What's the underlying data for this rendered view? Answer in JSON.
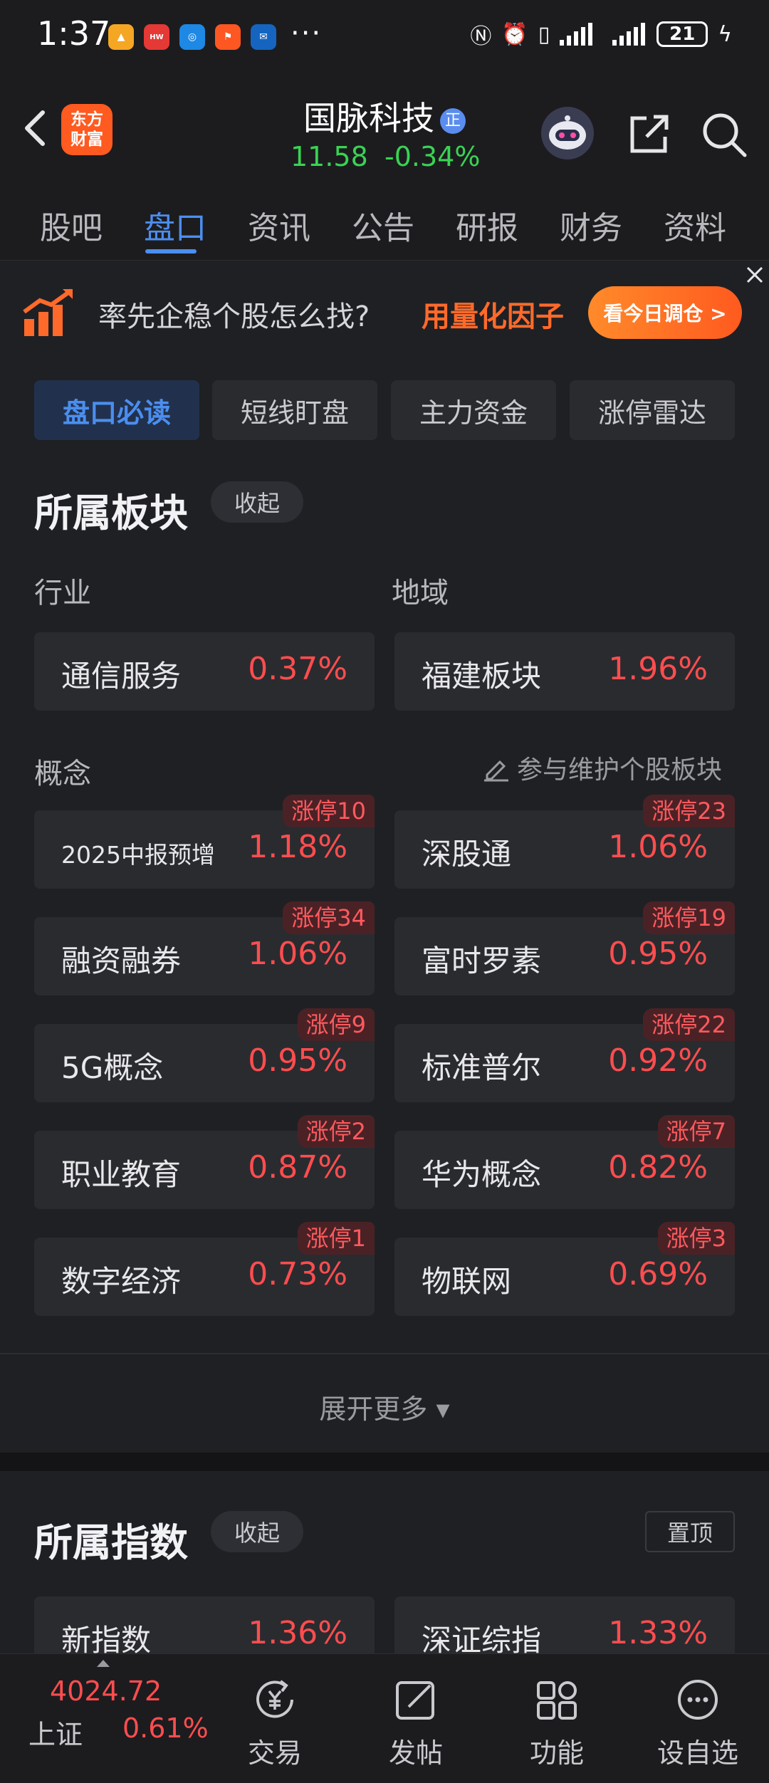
{
  "status_bar": {
    "time": "1:37",
    "dots": "···",
    "battery": "21"
  },
  "header": {
    "logo_line1": "东方",
    "logo_line2": "财富",
    "stock_name": "国脉科技",
    "badge": "正",
    "price": "11.58",
    "change": "-0.34%"
  },
  "tabs": [
    {
      "label": "股吧"
    },
    {
      "label": "盘口"
    },
    {
      "label": "资讯"
    },
    {
      "label": "公告"
    },
    {
      "label": "研报"
    },
    {
      "label": "财务"
    },
    {
      "label": "资料"
    }
  ],
  "banner": {
    "text": "率先企稳个股怎么找?",
    "highlight": "用量化因子",
    "button": "看今日调仓 >"
  },
  "subtabs": [
    {
      "label": "盘口必读"
    },
    {
      "label": "短线盯盘"
    },
    {
      "label": "主力资金"
    },
    {
      "label": "涨停雷达"
    }
  ],
  "sector_section": {
    "title": "所属板块",
    "collapse": "收起",
    "industry_label": "行业",
    "region_label": "地域",
    "industry": {
      "name": "通信服务",
      "pct": "0.37%"
    },
    "region": {
      "name": "福建板块",
      "pct": "1.96%"
    },
    "concept_label": "概念",
    "maintain_link": "参与维护个股板块",
    "concepts": [
      {
        "name": "2025中报预增",
        "pct": "1.18%",
        "badge": "涨停10"
      },
      {
        "name": "深股通",
        "pct": "1.06%",
        "badge": "涨停23"
      },
      {
        "name": "融资融券",
        "pct": "1.06%",
        "badge": "涨停34"
      },
      {
        "name": "富时罗素",
        "pct": "0.95%",
        "badge": "涨停19"
      },
      {
        "name": "5G概念",
        "pct": "0.95%",
        "badge": "涨停9"
      },
      {
        "name": "标准普尔",
        "pct": "0.92%",
        "badge": "涨停22"
      },
      {
        "name": "职业教育",
        "pct": "0.87%",
        "badge": "涨停2"
      },
      {
        "name": "华为概念",
        "pct": "0.82%",
        "badge": "涨停7"
      },
      {
        "name": "数字经济",
        "pct": "0.73%",
        "badge": "涨停1"
      },
      {
        "name": "物联网",
        "pct": "0.69%",
        "badge": "涨停3"
      }
    ],
    "expand_more": "展开更多 ▾"
  },
  "index_section": {
    "title": "所属指数",
    "collapse": "收起",
    "pin": "置顶",
    "items": [
      {
        "name": "新指数",
        "pct": "1.36%"
      },
      {
        "name": "深证综指",
        "pct": "1.33%"
      }
    ]
  },
  "bottom_bar": {
    "index_value": "4024.72",
    "index_name": "上证",
    "index_pct": "0.61%",
    "nav": [
      {
        "label": "交易",
        "icon": "yuan-exchange-icon"
      },
      {
        "label": "发帖",
        "icon": "edit-post-icon"
      },
      {
        "label": "功能",
        "icon": "grid-function-icon"
      },
      {
        "label": "设自选",
        "icon": "more-circle-icon"
      }
    ]
  },
  "colors": {
    "accent": "#4b8ef0",
    "up": "#ff4d4f",
    "down": "#39d353",
    "banner_orange": "#ff6a2a"
  }
}
